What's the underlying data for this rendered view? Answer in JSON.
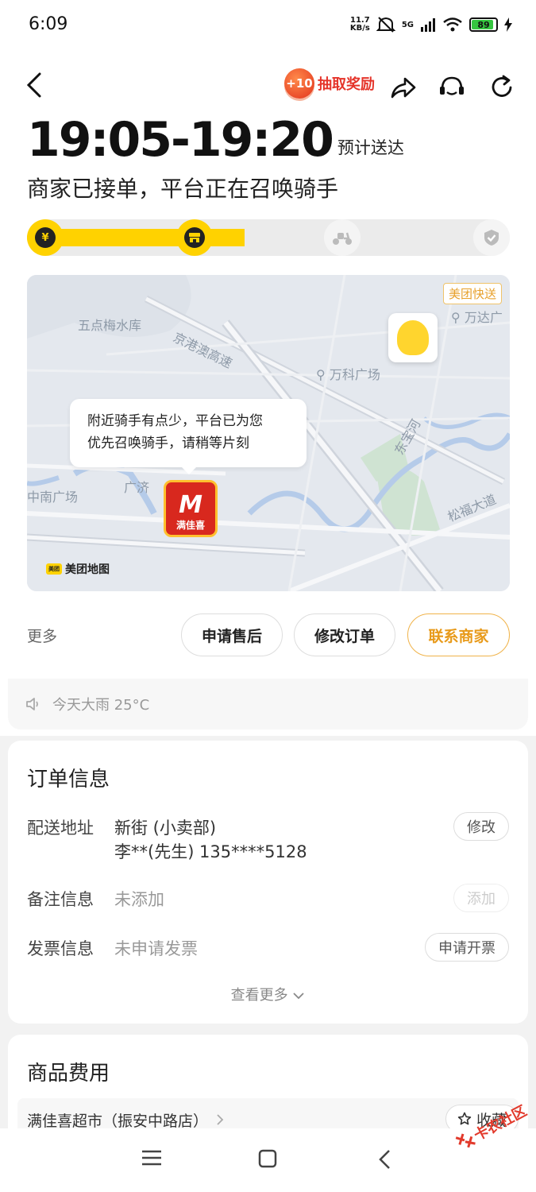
{
  "status_bar": {
    "time": "6:09",
    "net_speed_value": "11.7",
    "net_speed_unit": "KB/s",
    "network": "5G",
    "battery": "89"
  },
  "top_nav": {
    "reward_badge": "+10",
    "reward_label": "抽取奖励"
  },
  "eta": {
    "time_range": "19:05-19:20",
    "label": "预计送达"
  },
  "order_status": "商家已接单，平台正在召唤骑手",
  "progress": {
    "fraction": 0.45,
    "steps": [
      "paid-yuan-icon",
      "merchant-store-icon",
      "rider-icon",
      "delivered-check-icon"
    ],
    "completed_steps": 2,
    "active_color": "#ffd200"
  },
  "map": {
    "service_badge": "美团快送",
    "labels": {
      "l1": "五点梅水库",
      "l2": "京港澳高速",
      "l3": "万达广",
      "l4": "万科广场",
      "l5": "中南广场",
      "l6": "广济",
      "l7": "东宝河",
      "l8": "松福大道"
    },
    "tooltip_line1": "附近骑手有点少，平台已为您",
    "tooltip_line2": "优先召唤骑手，请稍等片刻",
    "store_marker_logo": "M",
    "store_marker_name": "满佳喜",
    "map_logo_small": "美团",
    "map_logo": "美团地图"
  },
  "actions": {
    "more": "更多",
    "after_sale": "申请售后",
    "modify_order": "修改订单",
    "contact_merchant": "联系商家"
  },
  "weather": "今天大雨 25°C",
  "order_info": {
    "title": "订单信息",
    "address_label": "配送地址",
    "address_line1": "新街 (小卖部)",
    "address_line2": "李**(先生) 135****5128",
    "address_action": "修改",
    "remark_label": "备注信息",
    "remark_value": "未添加",
    "remark_action": "添加",
    "invoice_label": "发票信息",
    "invoice_value": "未申请发票",
    "invoice_action": "申请开票",
    "see_more": "查看更多"
  },
  "goods_fee": {
    "title": "商品费用",
    "shop_name": "满佳喜超市（振安中路店）",
    "favorite": "收藏"
  },
  "watermark": "卡农社区"
}
